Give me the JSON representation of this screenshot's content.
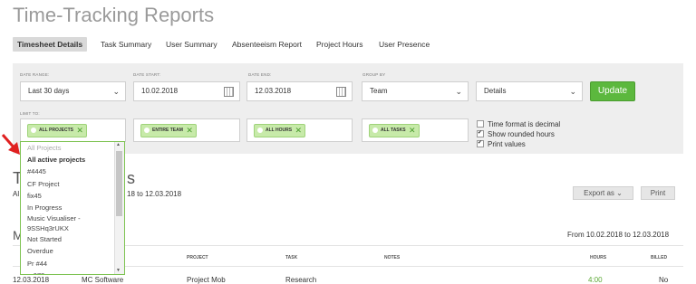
{
  "title": "Time-Tracking Reports",
  "tabs": [
    "Timesheet Details",
    "Task Summary",
    "User Summary",
    "Absenteeism Report",
    "Project Hours",
    "User Presence"
  ],
  "filters": {
    "date_range": {
      "label": "DATE RANGE:",
      "value": "Last 30 days"
    },
    "date_start": {
      "label": "DATE START:",
      "value": "10.02.2018"
    },
    "date_end": {
      "label": "DATE END:",
      "value": "12.03.2018"
    },
    "group_by": {
      "label": "GROUP BY",
      "value": "Team"
    },
    "detail": {
      "value": "Details"
    },
    "update_label": "Update",
    "limit_label": "LIMIT TO:",
    "tags": [
      "ALL PROJECTS",
      "ENTIRE TEAM",
      "ALL HOURS",
      "ALL TASKS"
    ],
    "options": [
      {
        "label": "Time format is decimal",
        "checked": false
      },
      {
        "label": "Show rounded hours",
        "checked": true
      },
      {
        "label": "Print values",
        "checked": true
      }
    ]
  },
  "dropdown": {
    "placeholder": "All Projects",
    "items": [
      "All active projects",
      "#4445",
      "CF Project",
      "fix45",
      "In Progress",
      "Music Visualiser -",
      "9SSHq3rUKX",
      "Not Started",
      "Overdue",
      "Pr #44",
      "pr678"
    ]
  },
  "report": {
    "heading_visible": "T",
    "heading_tail": "s",
    "sub_prefix": "Al",
    "date_range_text": "18 to 12.03.2018",
    "export_label": "Export as",
    "print_label": "Print",
    "section_letter": "M",
    "range_right": "From 10.02.2018 to 12.03.2018"
  },
  "table": {
    "headers": [
      "PROJECT",
      "TASK",
      "NOTES",
      "HOURS",
      "BILLED"
    ],
    "row": {
      "date": "12.03.2018",
      "user": "MC Software",
      "project": "Project Mob",
      "task": "Research",
      "notes": "",
      "hours": "4:00",
      "billed": "No"
    }
  },
  "colors": {
    "accent": "#5cb83e",
    "arrow": "#e02020",
    "hours_green": "#5aa832"
  }
}
